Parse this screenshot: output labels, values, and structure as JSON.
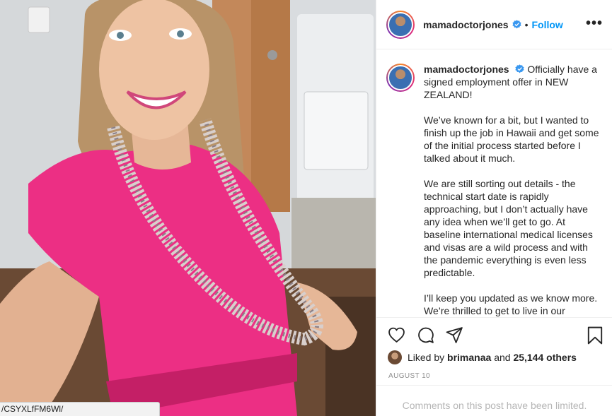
{
  "status_bar": {
    "url_text": "/CSYXLfFM6Wl/"
  },
  "header": {
    "username": "mamadoctorjones",
    "separator": "•",
    "follow_label": "Follow",
    "more_label": "•••"
  },
  "caption": {
    "username": "mamadoctorjones",
    "paragraphs": [
      "Officially have a signed employment offer in NEW ZEALAND!",
      "We’ve known for a bit, but I wanted to finish up the job in Hawaii and get some of the initial process started before I talked about it much.",
      "We are still sorting out details - the technical start date is rapidly approaching, but I don’t actually have any idea when we’ll get to go. At baseline international medical licenses and visas are a wild process and with the pandemic everything is even less predictable.",
      "I’ll keep you updated as we know more. We’re thrilled to get to live in our"
    ]
  },
  "likes": {
    "prefix": "Liked by",
    "user": "brimanaa",
    "middle": "and",
    "count": "25,144 others"
  },
  "date": "AUGUST 10",
  "comments_limited": "Comments on this post have been limited.",
  "colors": {
    "accent": "#0095f6",
    "scrubs": "#ec2f84",
    "border": "#efefef"
  },
  "icons": [
    "heart-icon",
    "comment-icon",
    "share-icon",
    "bookmark-icon",
    "verified-icon",
    "more-icon"
  ]
}
